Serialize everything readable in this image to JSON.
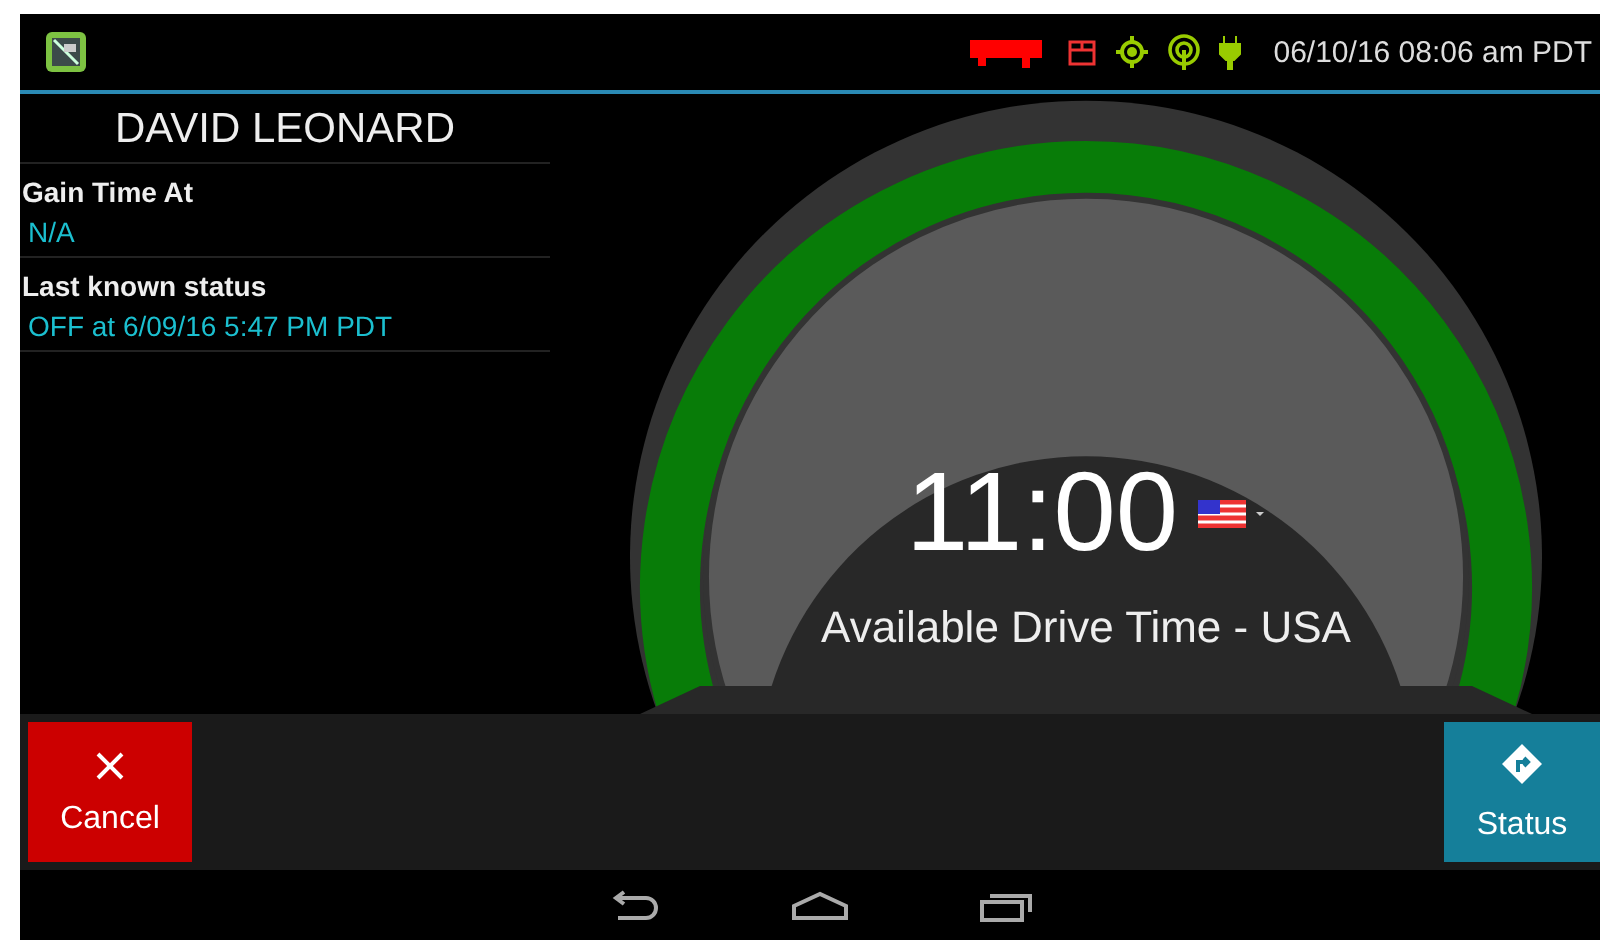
{
  "status_bar": {
    "time": "06/10/16 08:06 am PDT"
  },
  "driver": {
    "name": "DAVID LEONARD"
  },
  "info": [
    {
      "label": "Gain Time At",
      "value": "N/A"
    },
    {
      "label": "Last known status",
      "value": "OFF at 6/09/16 5:47 PM PDT"
    }
  ],
  "gauge": {
    "time": "11:00",
    "caption": "Available Drive Time - USA"
  },
  "actions": [
    {
      "label": "Cancel",
      "kind": "cancel"
    },
    {
      "label": "Status",
      "kind": "status"
    }
  ]
}
